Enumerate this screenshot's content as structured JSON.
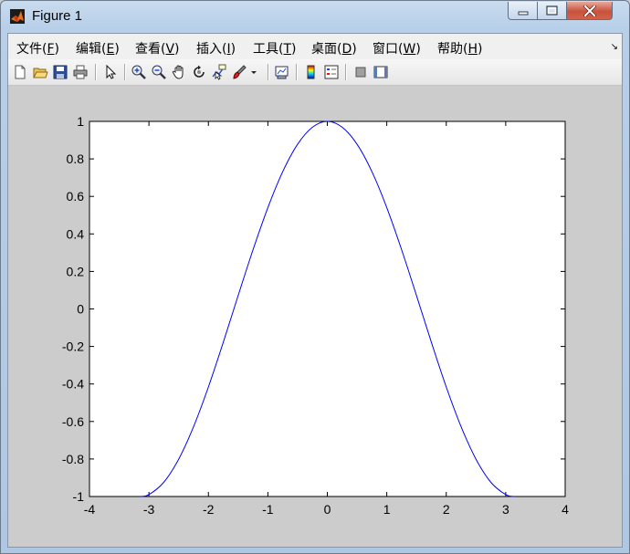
{
  "window": {
    "title": "Figure 1"
  },
  "menu": [
    {
      "label": "文件(",
      "key": "F",
      "end": ")"
    },
    {
      "label": "编辑(",
      "key": "E",
      "end": ")"
    },
    {
      "label": "查看(",
      "key": "V",
      "end": ")"
    },
    {
      "label": "插入(",
      "key": "I",
      "end": ")"
    },
    {
      "label": "工具(",
      "key": "T",
      "end": ")"
    },
    {
      "label": "桌面(",
      "key": "D",
      "end": ")"
    },
    {
      "label": "窗口(",
      "key": "W",
      "end": ")"
    },
    {
      "label": "帮助(",
      "key": "H",
      "end": ")"
    }
  ],
  "toolbar": [
    {
      "icon": "new-figure-icon"
    },
    {
      "icon": "open-file-icon"
    },
    {
      "icon": "save-icon"
    },
    {
      "icon": "print-icon"
    },
    {
      "icon": "edit-plot-arrow-icon"
    },
    {
      "icon": "zoom-in-icon"
    },
    {
      "icon": "zoom-out-icon"
    },
    {
      "icon": "pan-hand-icon"
    },
    {
      "icon": "rotate-3d-icon"
    },
    {
      "icon": "data-cursor-icon"
    },
    {
      "icon": "brush-icon"
    },
    {
      "icon": "link-plot-icon"
    },
    {
      "icon": "colorbar-icon"
    },
    {
      "icon": "legend-icon"
    },
    {
      "icon": "hide-plot-tools-icon"
    },
    {
      "icon": "show-plot-tools-icon"
    }
  ],
  "colors": {
    "line": "#0000ff",
    "axes_bg": "#ffffff",
    "figure_bg": "#cccccc"
  },
  "chart_data": {
    "type": "line",
    "title": "",
    "xlabel": "",
    "ylabel": "",
    "xlim": [
      -4,
      4
    ],
    "ylim": [
      -1,
      1
    ],
    "xticks": [
      "-4",
      "-3",
      "-2",
      "-1",
      "0",
      "1",
      "2",
      "3",
      "4"
    ],
    "yticks": [
      "-1",
      "-0.8",
      "-0.6",
      "-0.4",
      "-0.2",
      "0",
      "0.2",
      "0.4",
      "0.6",
      "0.8",
      "1"
    ],
    "grid": false,
    "legend": "none",
    "series": [
      {
        "x": [
          -3.1416,
          -3.0,
          -2.75,
          -2.5,
          -2.25,
          -2.0,
          -1.75,
          -1.5,
          -1.25,
          -1.0,
          -0.75,
          -0.5,
          -0.25,
          0.0,
          0.25,
          0.5,
          0.75,
          1.0,
          1.25,
          1.5,
          1.75,
          2.0,
          2.25,
          2.5,
          2.75,
          3.0,
          3.1416
        ],
        "y": [
          -1.0,
          -0.99,
          -0.924,
          -0.801,
          -0.628,
          -0.416,
          -0.178,
          0.071,
          0.315,
          0.54,
          0.732,
          0.878,
          0.969,
          1.0,
          0.969,
          0.878,
          0.732,
          0.54,
          0.315,
          0.071,
          -0.178,
          -0.416,
          -0.628,
          -0.801,
          -0.924,
          -0.99,
          -1.0
        ]
      }
    ]
  }
}
